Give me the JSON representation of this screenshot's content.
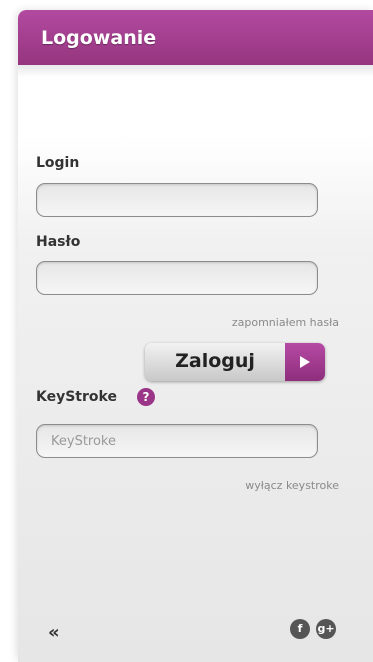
{
  "header": {
    "title": "Logowanie"
  },
  "form": {
    "login_label": "Login",
    "login_value": "",
    "password_label": "Hasło",
    "password_value": "",
    "forgot_link": "zapomniałem hasła",
    "submit_label": "Zaloguj",
    "keystroke_label": "KeyStroke",
    "keystroke_help": "?",
    "keystroke_placeholder": "KeyStroke",
    "keystroke_toggle": "wyłącz keystroke"
  },
  "footer": {
    "back_label": "«",
    "facebook_label": "f",
    "googleplus_label": "g+"
  },
  "colors": {
    "accent": "#9b3588",
    "header": "#a6418f"
  },
  "icons": [
    "arrow-right-icon",
    "help-icon",
    "double-chevron-left-icon",
    "facebook-icon",
    "google-plus-icon"
  ]
}
